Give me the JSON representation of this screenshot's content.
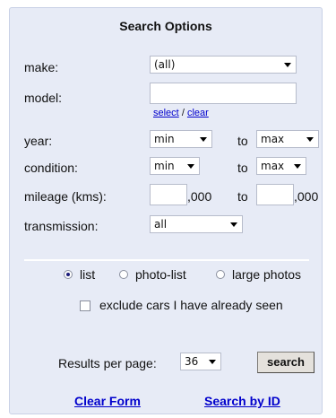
{
  "title": "Search Options",
  "fields": {
    "make_label": "make:",
    "make_value": "(all)",
    "model_label": "model:",
    "model_value": "",
    "select_link": "select",
    "link_sep": "/",
    "clear_link": "clear",
    "year_label": "year:",
    "year_min": "min",
    "year_to": "to",
    "year_max": "max",
    "condition_label": "condition:",
    "condition_min": "min",
    "condition_to": "to",
    "condition_max": "max",
    "mileage_label": "mileage (kms):",
    "mileage_min_value": "",
    "mileage_suffix1": ",000",
    "mileage_to": "to",
    "mileage_max_value": "",
    "mileage_suffix2": ",000",
    "transmission_label": "transmission:",
    "transmission_value": "all"
  },
  "view_options": {
    "list": "list",
    "photo_list": "photo-list",
    "large_photos": "large photos",
    "selected": "list"
  },
  "exclude_label": "exclude cars I have already seen",
  "results": {
    "label": "Results per page:",
    "value": "36",
    "search_button": "search"
  },
  "footer": {
    "clear_form": "Clear Form",
    "search_by_id": "Search by ID"
  },
  "colors": {
    "panel_bg": "#e7ebf6",
    "link": "#0000cc"
  }
}
